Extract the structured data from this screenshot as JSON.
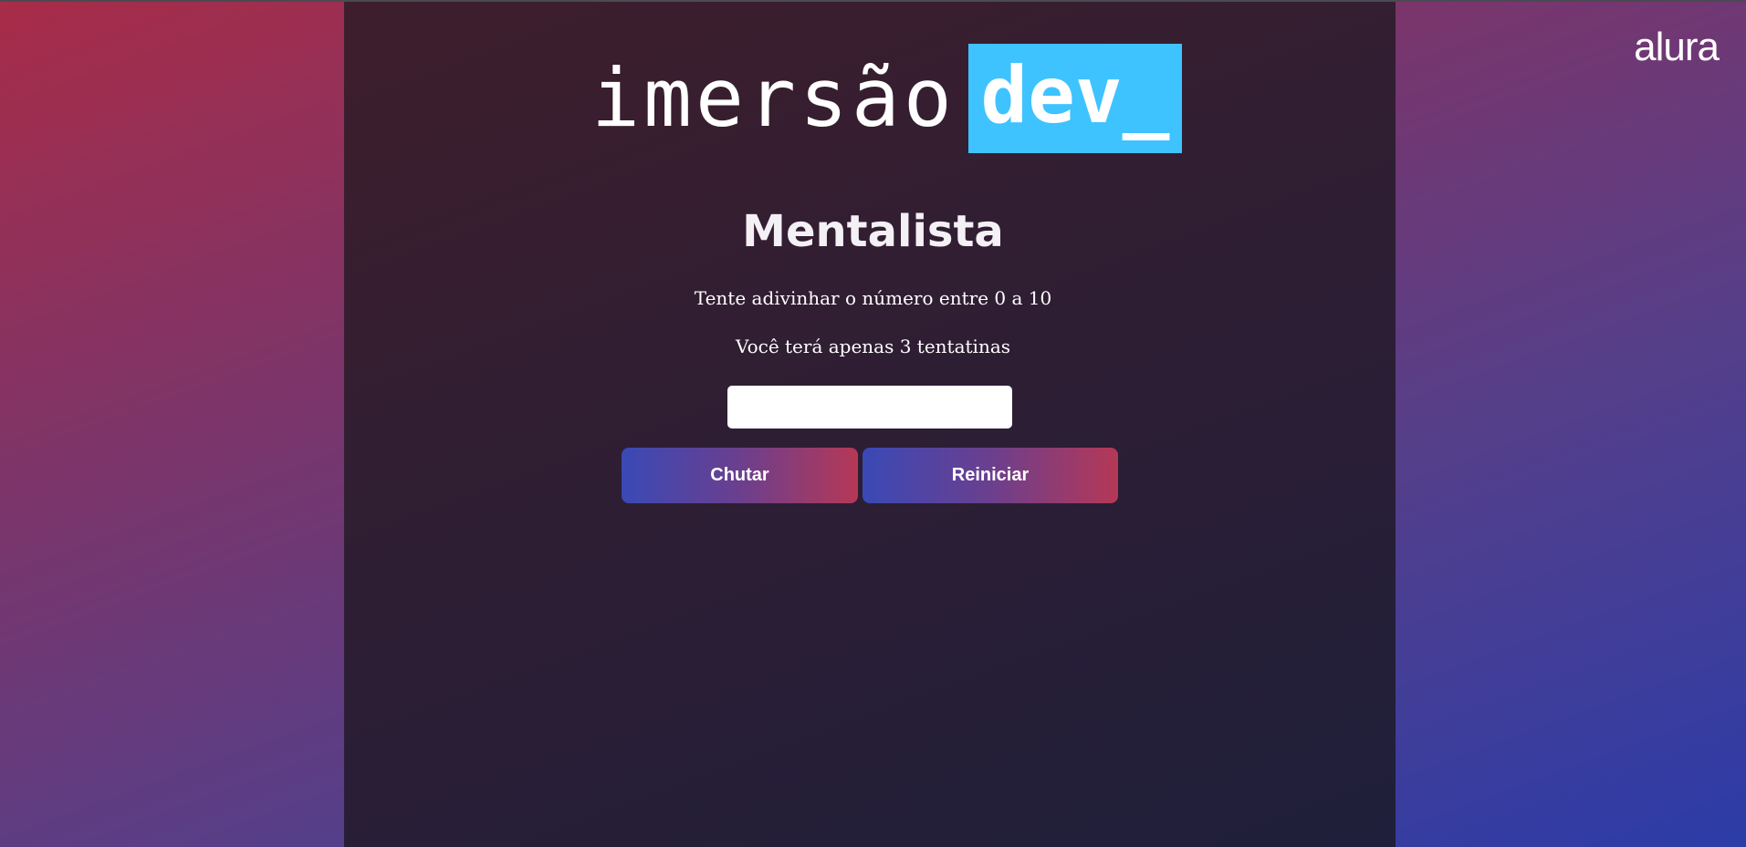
{
  "header": {
    "logo_word": "imersão",
    "logo_badge": "dev_",
    "brand": "alura"
  },
  "game": {
    "title": "Mentalista",
    "instruction": "Tente adivinhar o número entre 0 a 10",
    "attempts_note": "Você terá apenas 3 tentatinas",
    "guess_value": "",
    "guess_button_label": "Chutar",
    "restart_button_label": "Reiniciar"
  },
  "colors": {
    "badge_bg": "#3ec3ff",
    "button_gradient_start": "#3a49b6",
    "button_gradient_end": "#b53856"
  }
}
